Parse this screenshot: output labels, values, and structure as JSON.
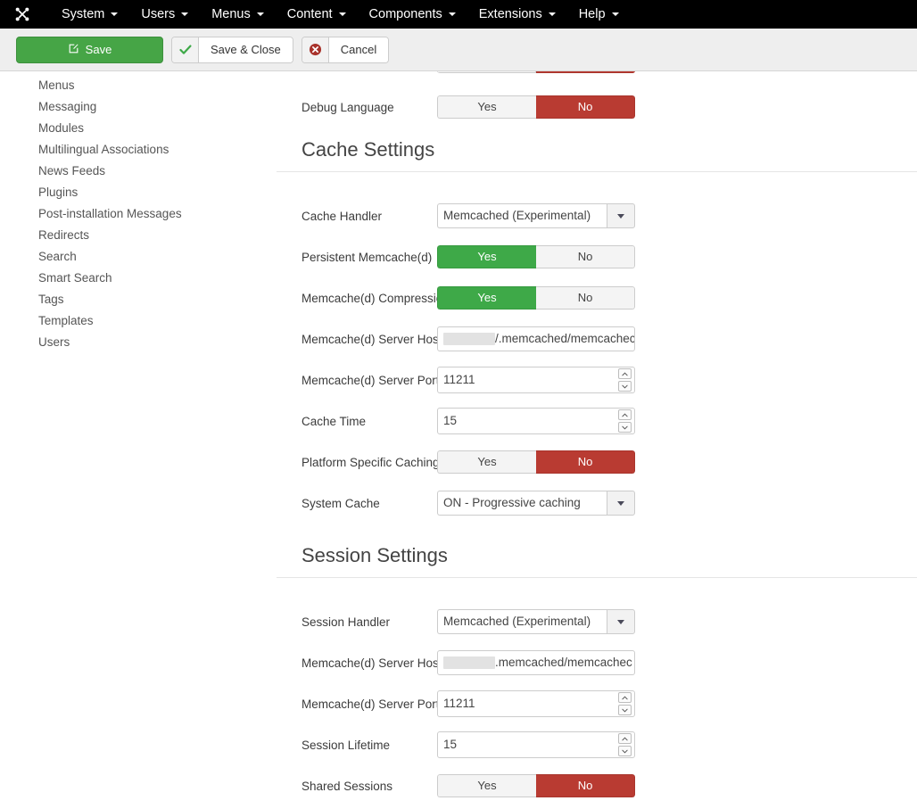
{
  "navbar": {
    "brand_icon": "joomla-logo-icon",
    "items": [
      {
        "label": "System",
        "has_caret": true
      },
      {
        "label": "Users",
        "has_caret": true
      },
      {
        "label": "Menus",
        "has_caret": true
      },
      {
        "label": "Content",
        "has_caret": true
      },
      {
        "label": "Components",
        "has_caret": true
      },
      {
        "label": "Extensions",
        "has_caret": true
      },
      {
        "label": "Help",
        "has_caret": true
      }
    ]
  },
  "toolbar": {
    "save_label": "Save",
    "save_icon": "edit-pencil-icon",
    "save_close_label": "Save & Close",
    "save_close_icon": "check-icon",
    "cancel_label": "Cancel",
    "cancel_icon": "cancel-circle-icon"
  },
  "sidebar": {
    "items": [
      {
        "label": "Menus"
      },
      {
        "label": "Messaging"
      },
      {
        "label": "Modules"
      },
      {
        "label": "Multilingual Associations"
      },
      {
        "label": "News Feeds"
      },
      {
        "label": "Plugins"
      },
      {
        "label": "Post-installation Messages"
      },
      {
        "label": "Redirects"
      },
      {
        "label": "Search"
      },
      {
        "label": "Smart Search"
      },
      {
        "label": "Tags"
      },
      {
        "label": "Templates"
      },
      {
        "label": "Users"
      }
    ]
  },
  "toggle_labels": {
    "yes": "Yes",
    "no": "No"
  },
  "colors": {
    "green": "#3ea948",
    "red": "#b93b32",
    "save_green": "#46a546",
    "navbar_bg": "#000000",
    "toolbar_bg": "#eeeeee"
  },
  "form": {
    "partial_top_row": {
      "name": "cut-off-toggle",
      "selected": "No"
    },
    "debug_language": {
      "label": "Debug Language",
      "selected": "No"
    },
    "cache_section": {
      "heading": "Cache Settings",
      "cache_handler": {
        "label": "Cache Handler",
        "value": "Memcached (Experimental)"
      },
      "persistent_memcache": {
        "label": "Persistent Memcache(d)",
        "selected": "Yes"
      },
      "memcache_compression": {
        "label": "Memcache(d) Compression",
        "selected": "Yes"
      },
      "server_host": {
        "label": "Memcache(d) Server Host",
        "redacted": true,
        "value_visible": "/.memcached/memcachec"
      },
      "server_port": {
        "label": "Memcache(d) Server Port",
        "value": "11211"
      },
      "cache_time": {
        "label": "Cache Time",
        "value": "15"
      },
      "platform_specific_caching": {
        "label": "Platform Specific Caching",
        "selected": "No"
      },
      "system_cache": {
        "label": "System Cache",
        "value": "ON - Progressive caching"
      }
    },
    "session_section": {
      "heading": "Session Settings",
      "session_handler": {
        "label": "Session Handler",
        "value": "Memcached (Experimental)"
      },
      "server_host": {
        "label": "Memcache(d) Server Host",
        "redacted": true,
        "value_visible": ".memcached/memcachec"
      },
      "server_port": {
        "label": "Memcache(d) Server Port",
        "value": "11211"
      },
      "session_lifetime": {
        "label": "Session Lifetime",
        "value": "15"
      },
      "shared_sessions": {
        "label": "Shared Sessions",
        "selected": "No"
      }
    }
  }
}
